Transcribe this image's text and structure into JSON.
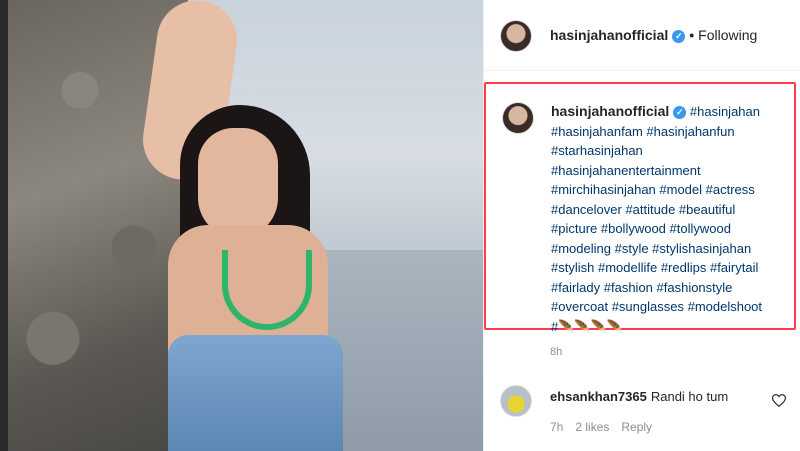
{
  "post": {
    "username": "hasinjahanofficial",
    "verified_mark": "✓",
    "separator": "•",
    "follow_status": "Following"
  },
  "caption": {
    "username": "hasinjahanofficial",
    "lines": [
      "#hasinjahan",
      "#hasinjahanfam #hasinjahanfun",
      "#starhasinjahan",
      "#hasinjahanentertainment",
      "#mirchihasinjahan #model #actress",
      "#dancelover #attitude #beautiful",
      "#picture #bollywood #tollywood",
      "#modeling #style #stylishasinjahan",
      "#stylish #modellife #redlips #fairytail",
      "#fairlady #fashion #fashionstyle",
      "#overcoat #sunglasses #modelshoot",
      "#🪶🪶🪶🪶"
    ],
    "time": "8h"
  },
  "comment": {
    "username": "ehsankhan7365",
    "text": "Randi ho tum",
    "time": "7h",
    "likes": "2 likes",
    "reply": "Reply",
    "like_icon": "heart-outline-icon"
  }
}
